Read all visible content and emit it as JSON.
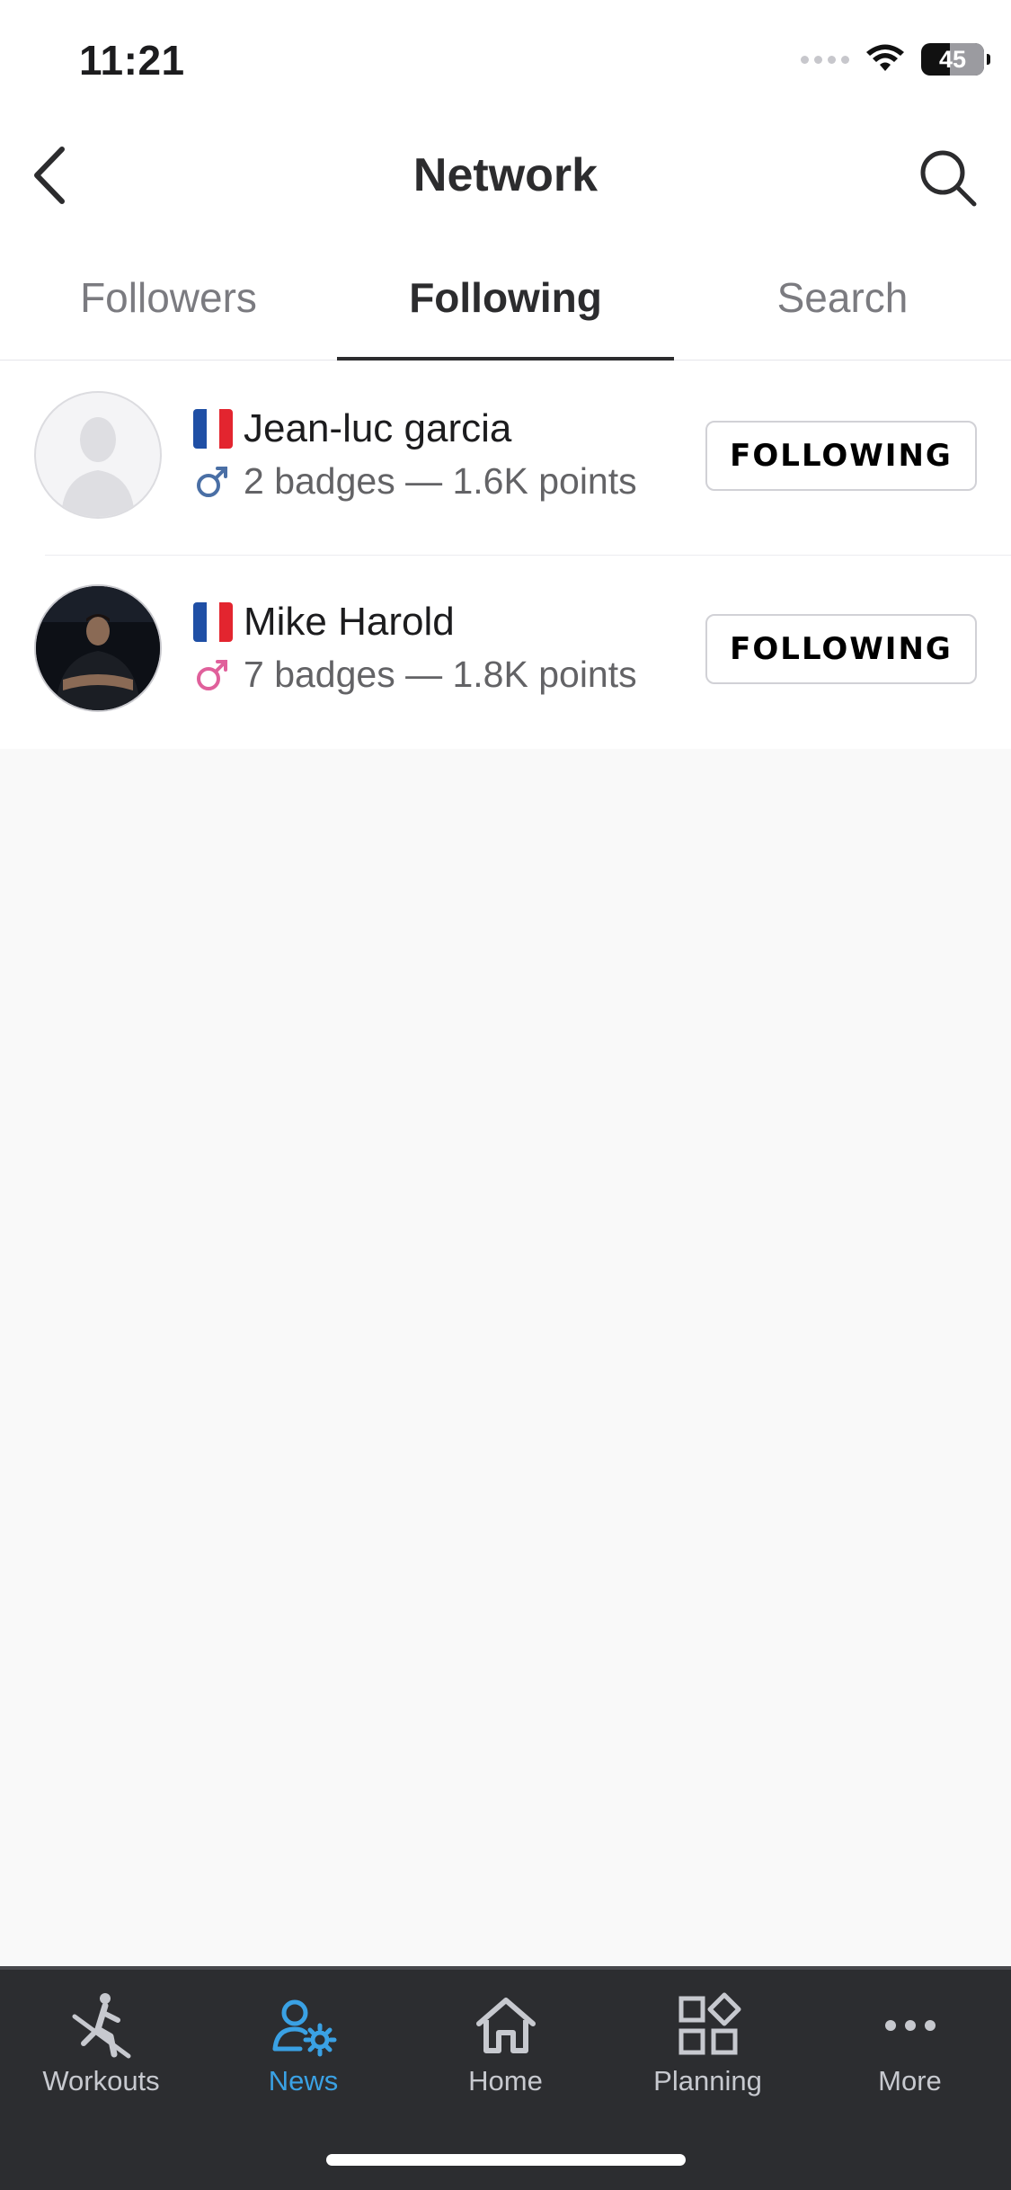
{
  "status_bar": {
    "time": "11:21",
    "battery": "45"
  },
  "header": {
    "title": "Network"
  },
  "tabs": [
    {
      "label": "Followers",
      "active": false
    },
    {
      "label": "Following",
      "active": true
    },
    {
      "label": "Search",
      "active": false
    }
  ],
  "users": [
    {
      "flag": "france-flag",
      "name": "Jean-luc garcia",
      "gender_icon": "male-symbol-icon",
      "gender_color": "#4a6fa5",
      "meta": "2 badges — 1.6K points",
      "button": "FOLLOWING",
      "avatar": "placeholder-avatar"
    },
    {
      "flag": "france-flag",
      "name": "Mike Harold",
      "gender_icon": "male-symbol-icon",
      "gender_color": "#e0609b",
      "meta": "7 badges — 1.8K points",
      "button": "FOLLOWING",
      "avatar": "photo-avatar"
    }
  ],
  "bottom_nav": [
    {
      "label": "Workouts",
      "icon": "rowing-icon",
      "active": false
    },
    {
      "label": "News",
      "icon": "user-gear-icon",
      "active": true
    },
    {
      "label": "Home",
      "icon": "home-icon",
      "active": false
    },
    {
      "label": "Planning",
      "icon": "grid-diamond-icon",
      "active": false
    },
    {
      "label": "More",
      "icon": "more-dots-icon",
      "active": false
    }
  ],
  "colors": {
    "accent": "#3aa1e4",
    "nav_bg": "#2c2d30",
    "nav_label": "#c7c9cf"
  }
}
